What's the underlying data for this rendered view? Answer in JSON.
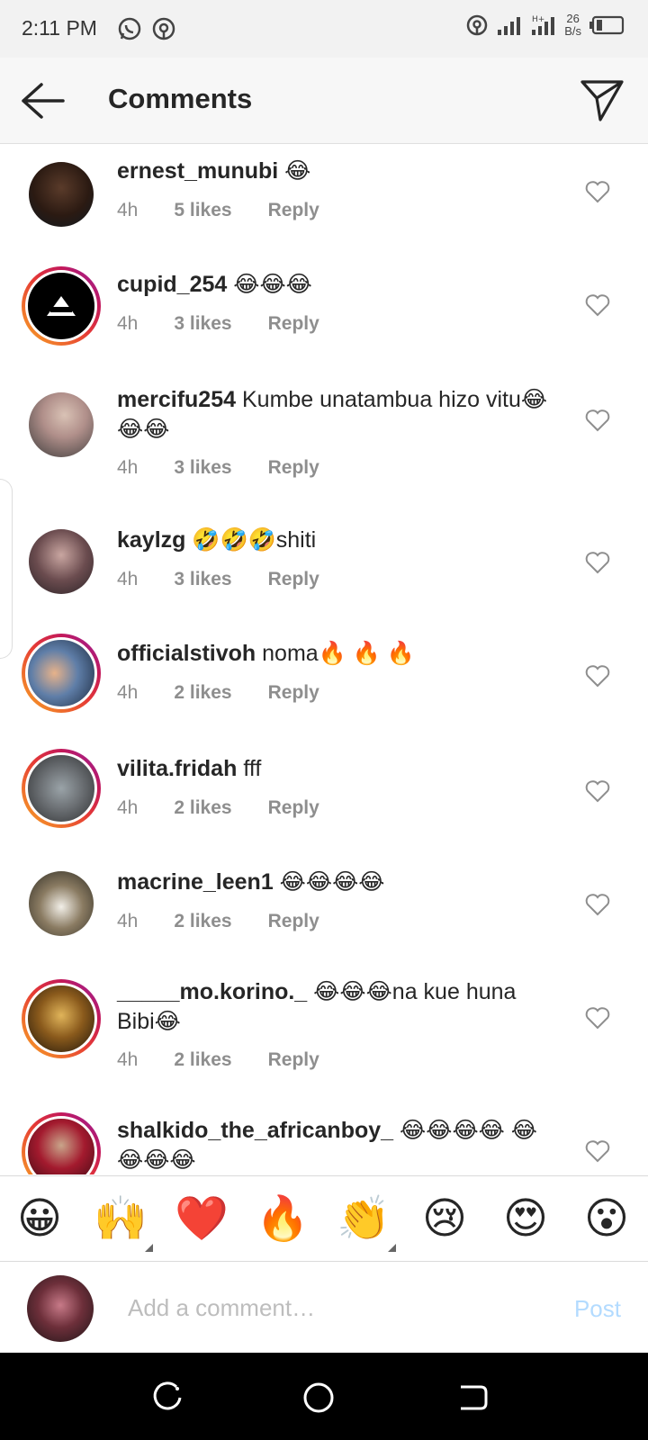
{
  "status": {
    "time": "2:11 PM",
    "net_speed_value": "26",
    "net_speed_unit": "B/s"
  },
  "header": {
    "title": "Comments"
  },
  "comments": [
    {
      "user": "ernest_munubi",
      "text": "😂",
      "time": "4h",
      "likes": "5 likes",
      "reply": "Reply"
    },
    {
      "user": "cupid_254",
      "text": "😂😂😂",
      "time": "4h",
      "likes": "3 likes",
      "reply": "Reply"
    },
    {
      "user": "mercifu254",
      "text": "Kumbe unatambua hizo vitu😂😂😂",
      "time": "4h",
      "likes": "3 likes",
      "reply": "Reply"
    },
    {
      "user": "kaylzg",
      "text": "🤣🤣🤣shiti",
      "time": "4h",
      "likes": "3 likes",
      "reply": "Reply"
    },
    {
      "user": "officialstivoh",
      "text": "noma🔥 🔥 🔥",
      "time": "4h",
      "likes": "2 likes",
      "reply": "Reply"
    },
    {
      "user": "vilita.fridah",
      "text": "fff",
      "time": "4h",
      "likes": "2 likes",
      "reply": "Reply"
    },
    {
      "user": "macrine_leen1",
      "text": "😂😂😂😂",
      "time": "4h",
      "likes": "2 likes",
      "reply": "Reply"
    },
    {
      "user": "_____mo.korino._",
      "text": "😂😂😂na kue huna Bibi😂",
      "time": "4h",
      "likes": "2 likes",
      "reply": "Reply"
    },
    {
      "user": "shalkido_the_africanboy_",
      "text": "😂😂😂😂 😂😂😂😂",
      "time": "",
      "likes": "",
      "reply": ""
    }
  ],
  "emoji_bar": [
    "😀",
    "🙌",
    "❤️",
    "🔥",
    "👏",
    "😢",
    "😍",
    "😮"
  ],
  "composer": {
    "placeholder": "Add a comment…",
    "post_label": "Post"
  },
  "colors": {
    "post_disabled": "#b3dbff",
    "meta_gray": "#8e8e8e",
    "story_ring_start": "#f9a825",
    "story_ring_end": "#c2185b"
  }
}
